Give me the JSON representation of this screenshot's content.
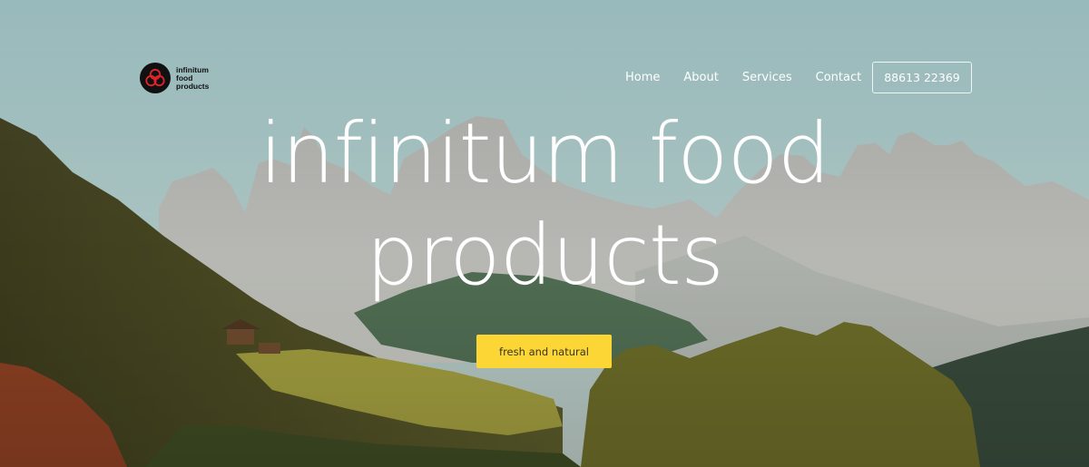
{
  "brand": {
    "name_line1": "infinitum",
    "name_line2": "food",
    "name_line3": "products",
    "mark_color": "#e0242a"
  },
  "nav": {
    "items": [
      {
        "label": "Home"
      },
      {
        "label": "About"
      },
      {
        "label": "Services"
      },
      {
        "label": "Contact"
      }
    ],
    "phone_label": "88613 22369"
  },
  "hero": {
    "title_line1": "infinitum food",
    "title_line2": "products",
    "cta_label": "fresh and natural",
    "cta_color": "#fcd635",
    "background": "mountain valley landscape"
  }
}
